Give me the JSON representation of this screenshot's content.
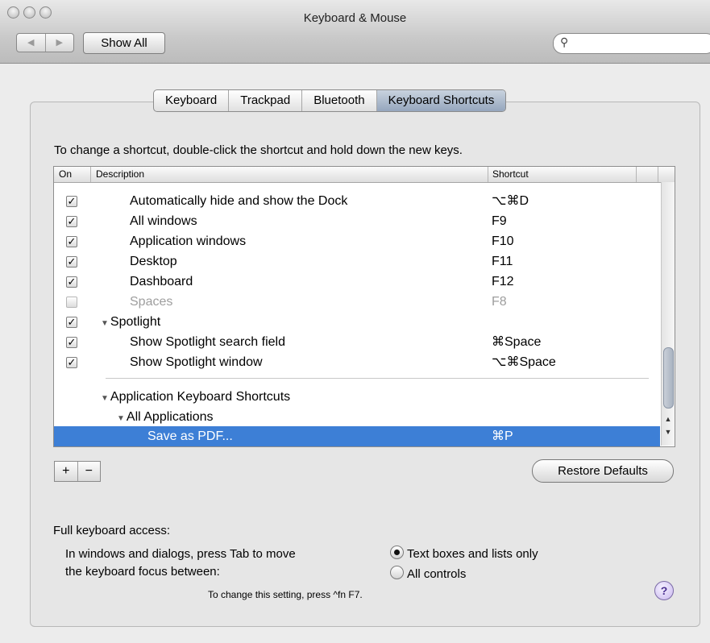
{
  "window": {
    "title": "Keyboard & Mouse"
  },
  "toolbar": {
    "back_icon": "back-arrow-icon",
    "forward_icon": "forward-arrow-icon",
    "show_all_label": "Show All",
    "search_placeholder": "",
    "search_icon": "magnifier-icon"
  },
  "tabs": [
    {
      "label": "Keyboard",
      "active": false
    },
    {
      "label": "Trackpad",
      "active": false
    },
    {
      "label": "Bluetooth",
      "active": false
    },
    {
      "label": "Keyboard Shortcuts",
      "active": true
    }
  ],
  "instructions": "To change a shortcut, double-click the shortcut and hold down the new keys.",
  "table": {
    "columns": {
      "on": "On",
      "description": "Description",
      "shortcut": "Shortcut"
    },
    "rows": [
      {
        "checked": true,
        "label": "Automatically hide and show the Dock",
        "shortcut": "⌥⌘D",
        "indent": 2,
        "disabled": false
      },
      {
        "checked": true,
        "label": "All windows",
        "shortcut": "F9",
        "indent": 2,
        "disabled": false
      },
      {
        "checked": true,
        "label": "Application windows",
        "shortcut": "F10",
        "indent": 2,
        "disabled": false
      },
      {
        "checked": true,
        "label": "Desktop",
        "shortcut": "F11",
        "indent": 2,
        "disabled": false
      },
      {
        "checked": true,
        "label": "Dashboard",
        "shortcut": "F12",
        "indent": 2,
        "disabled": false
      },
      {
        "checked": false,
        "label": "Spaces",
        "shortcut": "F8",
        "indent": 2,
        "disabled": true
      },
      {
        "checked": true,
        "label": "Spotlight",
        "shortcut": "",
        "indent": 1,
        "group": true,
        "disabled": false
      },
      {
        "checked": true,
        "label": "Show Spotlight search field",
        "shortcut": "⌘Space",
        "indent": 2,
        "disabled": false
      },
      {
        "checked": true,
        "label": "Show Spotlight window",
        "shortcut": "⌥⌘Space",
        "indent": 2,
        "disabled": false
      }
    ],
    "app_section": [
      {
        "label": "Application Keyboard Shortcuts",
        "indent": 1,
        "group": true
      },
      {
        "label": "All Applications",
        "indent": 2,
        "group": true
      },
      {
        "label": "Save as PDF...",
        "shortcut": "⌘P",
        "indent": 3,
        "selected": true
      }
    ]
  },
  "buttons": {
    "add": "+",
    "remove": "−",
    "restore": "Restore Defaults"
  },
  "full_keyboard_access": {
    "label": "Full keyboard access:",
    "desc_line1": "In windows and dialogs, press Tab to move",
    "desc_line2": "the keyboard focus between:",
    "options": [
      {
        "label": "Text boxes and lists only",
        "selected": true
      },
      {
        "label": "All controls",
        "selected": false
      }
    ],
    "hint": "To change this setting, press ^fn F7."
  },
  "help_label": "?"
}
